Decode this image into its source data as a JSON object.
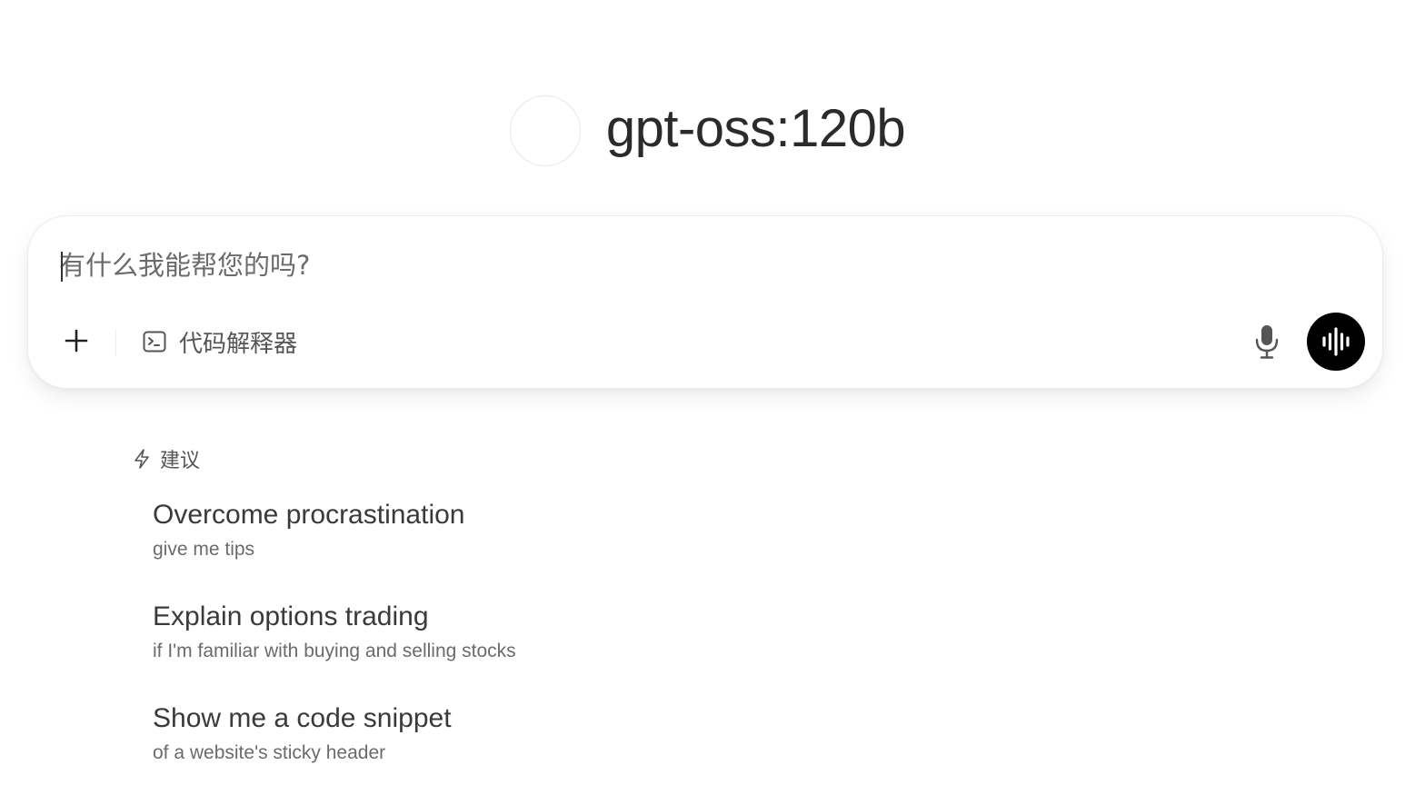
{
  "header": {
    "model_name": "gpt-oss:120b"
  },
  "chat": {
    "placeholder": "有什么我能帮您的吗?",
    "value": "",
    "tools": {
      "code_interpreter_label": "代码解释器"
    }
  },
  "icons": {
    "plus": "plus-icon",
    "code_interpreter": "terminal-icon",
    "mic": "microphone-icon",
    "voice": "audio-waveform-icon",
    "suggestions": "lightning-bolt-icon"
  },
  "colors": {
    "voice_button_bg": "#000000",
    "text_primary": "#333333",
    "text_secondary": "#6b6b6b"
  },
  "suggestions": {
    "title": "建议",
    "items": [
      {
        "title": "Overcome procrastination",
        "subtitle": "give me tips"
      },
      {
        "title": "Explain options trading",
        "subtitle": "if I'm familiar with buying and selling stocks"
      },
      {
        "title": "Show me a code snippet",
        "subtitle": "of a website's sticky header"
      }
    ]
  }
}
